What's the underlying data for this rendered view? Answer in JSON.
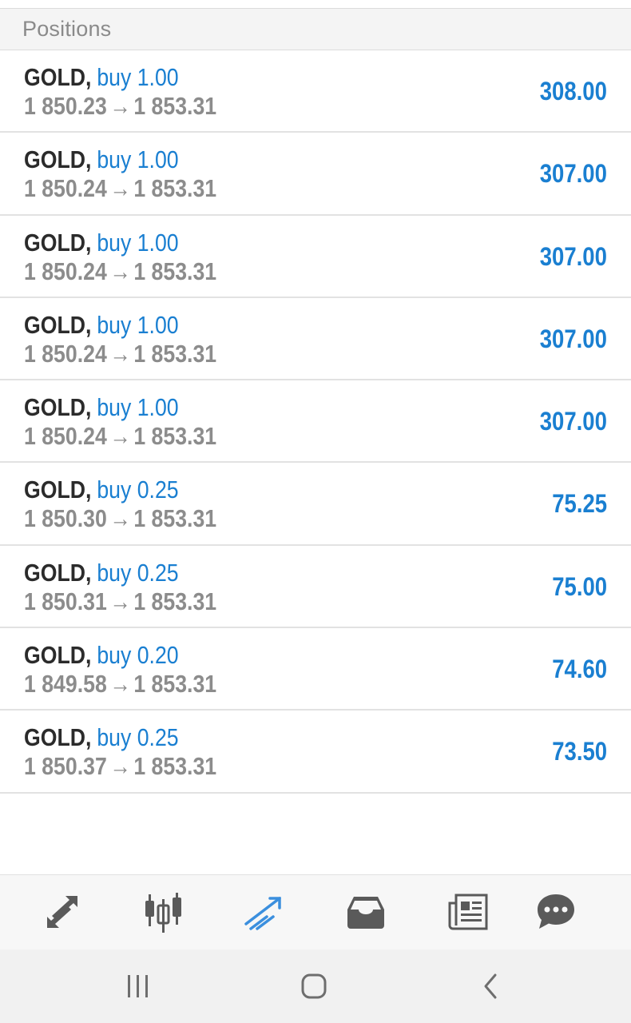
{
  "header": {
    "title": "Positions"
  },
  "positions": [
    {
      "symbol": "GOLD",
      "type": "buy",
      "volume": "1.00",
      "open_price": "1 850.23",
      "current_price": "1 853.31",
      "profit": "308.00"
    },
    {
      "symbol": "GOLD",
      "type": "buy",
      "volume": "1.00",
      "open_price": "1 850.24",
      "current_price": "1 853.31",
      "profit": "307.00"
    },
    {
      "symbol": "GOLD",
      "type": "buy",
      "volume": "1.00",
      "open_price": "1 850.24",
      "current_price": "1 853.31",
      "profit": "307.00"
    },
    {
      "symbol": "GOLD",
      "type": "buy",
      "volume": "1.00",
      "open_price": "1 850.24",
      "current_price": "1 853.31",
      "profit": "307.00"
    },
    {
      "symbol": "GOLD",
      "type": "buy",
      "volume": "1.00",
      "open_price": "1 850.24",
      "current_price": "1 853.31",
      "profit": "307.00"
    },
    {
      "symbol": "GOLD",
      "type": "buy",
      "volume": "0.25",
      "open_price": "1 850.30",
      "current_price": "1 853.31",
      "profit": "75.25"
    },
    {
      "symbol": "GOLD",
      "type": "buy",
      "volume": "0.25",
      "open_price": "1 850.31",
      "current_price": "1 853.31",
      "profit": "75.00"
    },
    {
      "symbol": "GOLD",
      "type": "buy",
      "volume": "0.20",
      "open_price": "1 849.58",
      "current_price": "1 853.31",
      "profit": "74.60"
    },
    {
      "symbol": "GOLD",
      "type": "buy",
      "volume": "0.25",
      "open_price": "1 850.37",
      "current_price": "1 853.31",
      "profit": "73.50"
    }
  ],
  "bottom_nav": {
    "items": [
      {
        "icon": "quotes-arrows-icon",
        "active": false
      },
      {
        "icon": "chart-candles-icon",
        "active": false
      },
      {
        "icon": "trade-icon",
        "active": true
      },
      {
        "icon": "history-inbox-icon",
        "active": false
      },
      {
        "icon": "news-icon",
        "active": false
      },
      {
        "icon": "messages-chat-icon",
        "active": false
      }
    ],
    "active_color": "#3b8fde",
    "inactive_color": "#5a5a5a"
  },
  "system_nav": {
    "items": [
      {
        "icon": "recent-apps-icon"
      },
      {
        "icon": "home-icon"
      },
      {
        "icon": "back-icon"
      }
    ]
  },
  "colors": {
    "accent": "#1a7fd1",
    "symbol_text": "#2b2b2b",
    "price_text": "#8c8c8c",
    "header_bg": "#f4f4f4"
  }
}
